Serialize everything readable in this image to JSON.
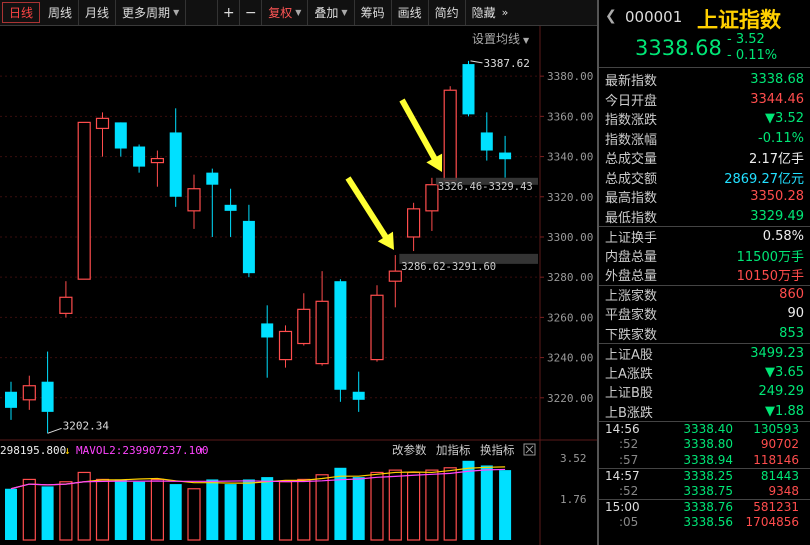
{
  "toolbar": {
    "periods": [
      "日线",
      "周线",
      "月线"
    ],
    "more": "更多周期",
    "plus": "+",
    "minus": "−",
    "fuquan": "复权",
    "overlay": "叠加",
    "chips": "筹码",
    "draw": "画线",
    "simple": "简约",
    "hide": "隐藏",
    "expand_icon": "double-right-arrow-icon",
    "setline": "设置均线"
  },
  "chart": {
    "price_ticks": [
      "3380.00",
      "3360.00",
      "3340.00",
      "3320.00",
      "3300.00",
      "3280.00",
      "3260.00",
      "3240.00",
      "3220.00"
    ],
    "high_label": "3387.62",
    "low_label": "3202.34",
    "gap1_label": "3326.46-3329.43",
    "gap2_label": "3286.62-3291.60",
    "vol_ticks": [
      "3.52",
      "1.76"
    ],
    "vol_label_a": "298195.800",
    "vol_label_b": "MAVOL2:239907237.100",
    "vol_btns": [
      "改参数",
      "加指标",
      "换指标"
    ],
    "close_icon": "close-icon",
    "up_color": "#ff4d4d",
    "down_color": "#00e0ff",
    "arrow_color": "#ffff33"
  },
  "chart_data": {
    "type": "candlestick",
    "ylim": [
      3200,
      3395
    ],
    "candles": [
      {
        "o": 3223,
        "c": 3215,
        "h": 3228,
        "l": 3209
      },
      {
        "o": 3219,
        "c": 3226,
        "h": 3231,
        "l": 3214
      },
      {
        "o": 3228,
        "c": 3213,
        "h": 3243,
        "l": 3202.34
      },
      {
        "o": 3262,
        "c": 3270,
        "h": 3278,
        "l": 3260
      },
      {
        "o": 3279,
        "c": 3357,
        "h": 3357,
        "l": 3279
      },
      {
        "o": 3354,
        "c": 3359,
        "h": 3362,
        "l": 3340
      },
      {
        "o": 3357,
        "c": 3344,
        "h": 3357,
        "l": 3340
      },
      {
        "o": 3345,
        "c": 3335,
        "h": 3346,
        "l": 3332
      },
      {
        "o": 3337,
        "c": 3339,
        "h": 3343,
        "l": 3325
      },
      {
        "o": 3352,
        "c": 3320,
        "h": 3364,
        "l": 3315
      },
      {
        "o": 3313,
        "c": 3324,
        "h": 3331,
        "l": 3304
      },
      {
        "o": 3332,
        "c": 3326,
        "h": 3334,
        "l": 3300
      },
      {
        "o": 3316,
        "c": 3313,
        "h": 3324,
        "l": 3300
      },
      {
        "o": 3308,
        "c": 3282,
        "h": 3316,
        "l": 3280
      },
      {
        "o": 3257,
        "c": 3250,
        "h": 3266,
        "l": 3230
      },
      {
        "o": 3239,
        "c": 3253,
        "h": 3256,
        "l": 3235
      },
      {
        "o": 3247,
        "c": 3264,
        "h": 3272,
        "l": 3246
      },
      {
        "o": 3237,
        "c": 3268,
        "h": 3283,
        "l": 3236
      },
      {
        "o": 3278,
        "c": 3224,
        "h": 3279,
        "l": 3218
      },
      {
        "o": 3223,
        "c": 3219,
        "h": 3233,
        "l": 3213
      },
      {
        "o": 3239,
        "c": 3271,
        "h": 3276,
        "l": 3238
      },
      {
        "o": 3278,
        "c": 3283,
        "h": 3291,
        "l": 3265
      },
      {
        "o": 3300,
        "c": 3314,
        "h": 3317,
        "l": 3293
      },
      {
        "o": 3313,
        "c": 3326,
        "h": 3329.43,
        "l": 3303
      },
      {
        "o": 3328,
        "c": 3373,
        "h": 3375,
        "l": 3328
      },
      {
        "o": 3386,
        "c": 3361,
        "h": 3387.62,
        "l": 3360
      },
      {
        "o": 3352,
        "c": 3343,
        "h": 3362,
        "l": 3338
      },
      {
        "o": 3342,
        "c": 3338.68,
        "h": 3350.28,
        "l": 3329.49
      }
    ],
    "volumes": [
      2.2,
      2.6,
      2.3,
      2.5,
      2.9,
      2.6,
      2.6,
      2.5,
      2.6,
      2.4,
      2.2,
      2.6,
      2.4,
      2.6,
      2.7,
      2.5,
      2.6,
      2.8,
      3.1,
      2.7,
      2.9,
      3.0,
      2.9,
      3.0,
      3.1,
      3.4,
      3.2,
      3.0
    ],
    "vol_ylim": [
      0,
      3.52
    ]
  },
  "panel": {
    "back_icon": "back-arrow-icon",
    "code": "000001",
    "name": "上证指数",
    "price": "3338.68",
    "chg": "- 3.52",
    "pct": "- 0.11%",
    "group1": [
      {
        "label": "最新指数",
        "value": "3338.68",
        "cls": "g"
      },
      {
        "label": "今日开盘",
        "value": "3344.46",
        "cls": "r"
      },
      {
        "label": "指数涨跌",
        "value": "▼3.52",
        "cls": "g"
      },
      {
        "label": "指数涨幅",
        "value": "-0.11%",
        "cls": "g"
      },
      {
        "label": "总成交量",
        "value": "2.17亿手",
        "cls": "w"
      },
      {
        "label": "总成交额",
        "value": "2869.27亿元",
        "cls": "c"
      },
      {
        "label": "最高指数",
        "value": "3350.28",
        "cls": "r"
      },
      {
        "label": "最低指数",
        "value": "3329.49",
        "cls": "g"
      }
    ],
    "group2": [
      {
        "label": "上证换手",
        "value": "0.58%",
        "cls": "w"
      },
      {
        "label": "内盘总量",
        "value": "11500万手",
        "cls": "g"
      },
      {
        "label": "外盘总量",
        "value": "10150万手",
        "cls": "r"
      }
    ],
    "group3": [
      {
        "label": "上涨家数",
        "value": "860",
        "cls": "r"
      },
      {
        "label": "平盘家数",
        "value": "90",
        "cls": "w"
      },
      {
        "label": "下跌家数",
        "value": "853",
        "cls": "g"
      }
    ],
    "group4": [
      {
        "label": "上证A股",
        "value": "3499.23",
        "cls": "g"
      },
      {
        "label": "上A涨跌",
        "value": "▼3.65",
        "cls": "g"
      },
      {
        "label": "上证B股",
        "value": "249.29",
        "cls": "g"
      },
      {
        "label": "上B涨跌",
        "value": "▼1.88",
        "cls": "g"
      }
    ],
    "ticks": [
      {
        "t": "14:56",
        "sub": false,
        "p": "3338.40",
        "v": "130593",
        "sep": false
      },
      {
        "t": ":52",
        "sub": true,
        "p": "3338.80",
        "v": "90702",
        "vc": "r",
        "sep": false
      },
      {
        "t": ":57",
        "sub": true,
        "p": "3338.94",
        "v": "118146",
        "vc": "r",
        "sep": false
      },
      {
        "t": "14:57",
        "sub": false,
        "p": "3338.25",
        "v": "81443",
        "sep": true
      },
      {
        "t": ":52",
        "sub": true,
        "p": "3338.75",
        "v": "9348",
        "vc": "r",
        "sep": false
      },
      {
        "t": "15:00",
        "sub": false,
        "p": "3338.76",
        "v": "581231",
        "vc": "r",
        "sep": true
      },
      {
        "t": ":05",
        "sub": true,
        "p": "3338.56",
        "v": "1704856",
        "vc": "r",
        "sep": false
      }
    ]
  }
}
